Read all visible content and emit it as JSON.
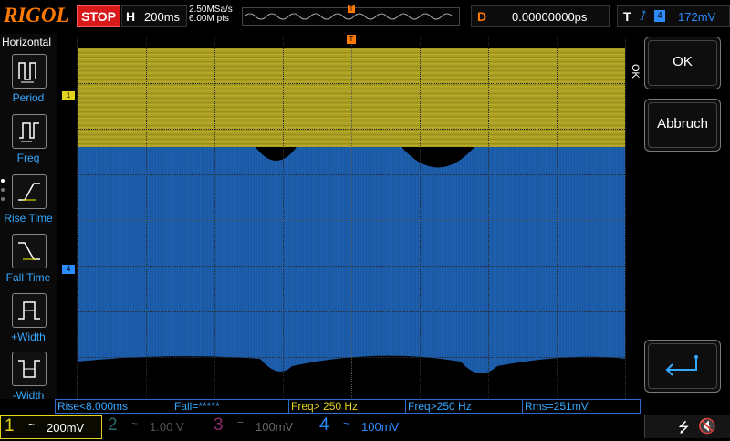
{
  "brand": {
    "logo": "RIGOL",
    "color": "#ff7a00"
  },
  "run_state": {
    "label": "STOP",
    "color": "#d81a1a"
  },
  "horizontal": {
    "key": "H",
    "timebase": "200ms"
  },
  "acquisition": {
    "sample_rate": "2.50MSa/s",
    "points": "6.00M pts"
  },
  "memory_trigger_marker": "T",
  "delay": {
    "key": "D",
    "value": "0.00000000ps"
  },
  "trigger": {
    "key": "T",
    "edge_icon": "rising-edge-icon",
    "source": "4",
    "level": "172mV"
  },
  "left_menu": {
    "title": "Horizontal",
    "items": [
      {
        "label": "Period",
        "icon": "period-icon"
      },
      {
        "label": "Freq",
        "icon": "freq-icon"
      },
      {
        "label": "Rise Time",
        "icon": "rise-time-icon"
      },
      {
        "label": "Fall Time",
        "icon": "fall-time-icon"
      },
      {
        "label": "+Width",
        "icon": "positive-width-icon"
      },
      {
        "label": "-Width",
        "icon": "negative-width-icon"
      }
    ]
  },
  "markers": {
    "ch1": "1",
    "ch4": "4",
    "trigger": "T",
    "top_trigger": "T"
  },
  "right_menu": {
    "side_label": "OK",
    "ok_label": "OK",
    "cancel_label": "Abbruch",
    "enter_icon": "enter-return-icon"
  },
  "measurements": [
    {
      "text": "Rise<8.000ms",
      "color": "blue"
    },
    {
      "text": "Fall=*****",
      "color": "blue"
    },
    {
      "text": "Freq> 250 Hz",
      "color": "yellow"
    },
    {
      "text": "Freq>250 Hz",
      "color": "blue"
    },
    {
      "text": "Rms=251mV",
      "color": "blue"
    }
  ],
  "channels": [
    {
      "num": "1",
      "coupling": "~",
      "scale": "200mV",
      "color": "#e3d31c",
      "active": true
    },
    {
      "num": "2",
      "coupling": "~",
      "scale": "1.00 V",
      "color": "#2a6d6d",
      "active": false
    },
    {
      "num": "3",
      "coupling": "=",
      "scale": "100mV",
      "color": "#8a2a6a",
      "active": false
    },
    {
      "num": "4",
      "coupling": "~",
      "scale": "100mV",
      "color": "#2b8cff",
      "active": true
    }
  ],
  "status": {
    "usb_icon": "usb-icon",
    "sound_icon": "speaker-muted-icon",
    "usb_glyph": "⭍",
    "sound_glyph": "🔇"
  }
}
